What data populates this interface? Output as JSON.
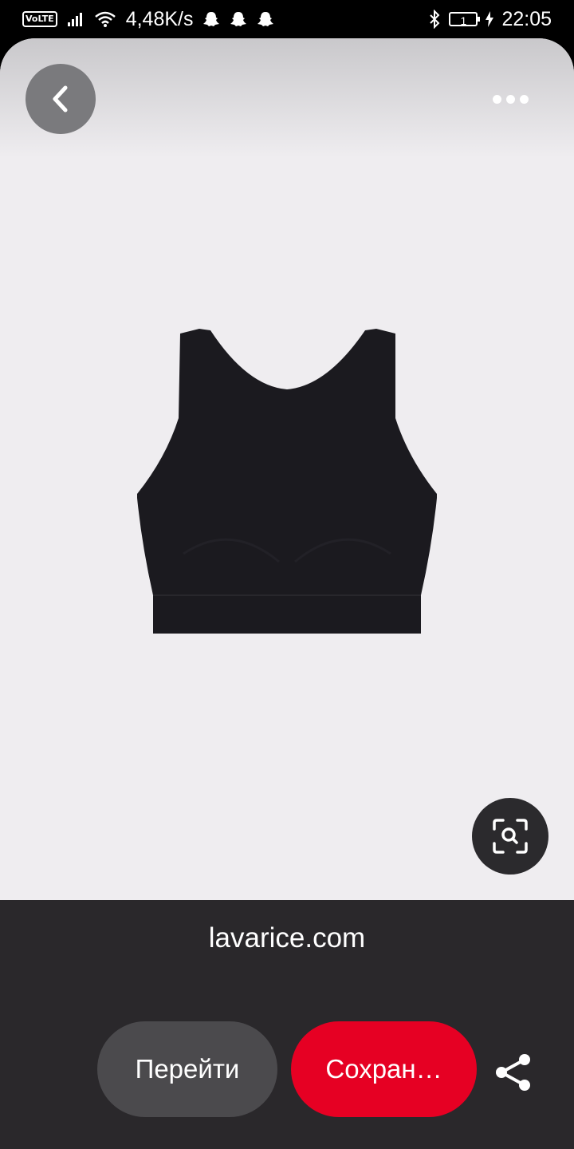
{
  "status_bar": {
    "volte": "VoLTE",
    "network_speed": "4,48K/s",
    "battery_level": "1",
    "time": "22:05",
    "icons": [
      "signal-icon",
      "wifi-icon",
      "snapchat-ghost-icon",
      "snapchat-ghost-icon",
      "snapchat-ghost-icon",
      "bluetooth-icon",
      "battery-icon",
      "charging-icon"
    ]
  },
  "header": {
    "back_icon": "chevron-left-icon",
    "more_icon": "more-horizontal-icon"
  },
  "product": {
    "image_icon": "black-crop-top-image",
    "background_color": "#efedf0"
  },
  "visual_search": {
    "icon": "visual-search-icon"
  },
  "footer": {
    "domain": "lavarice.com",
    "go_label": "Перейти",
    "save_label": "Сохран…",
    "share_icon": "share-icon"
  },
  "colors": {
    "save_button": "#e60023",
    "go_button": "#4b4a4d",
    "footer_bg": "#2a282b"
  }
}
